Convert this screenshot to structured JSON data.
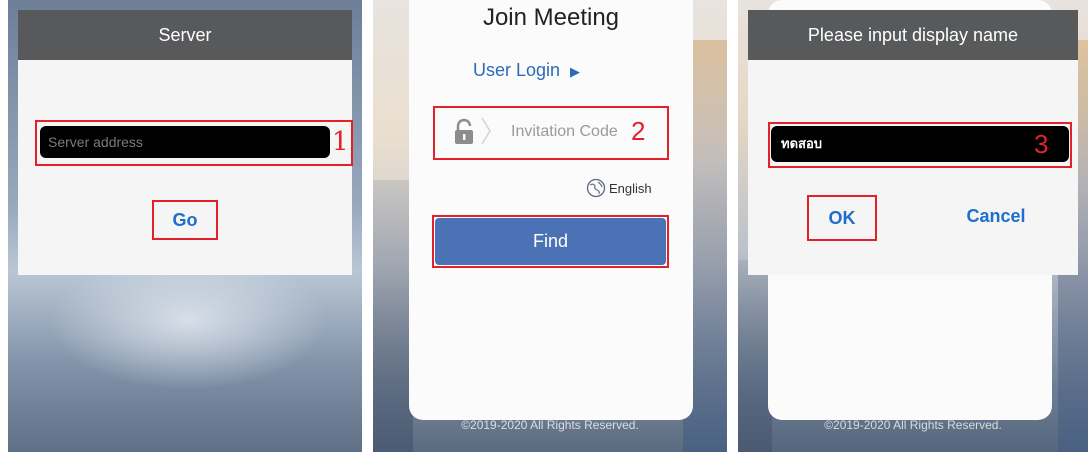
{
  "panel1": {
    "title": "Server",
    "server_placeholder": "Server address",
    "step_label": "1",
    "go_label": "Go"
  },
  "panel2": {
    "title": "Join Meeting",
    "user_login": "User Login",
    "invitation_placeholder": "Invitation Code",
    "step_label": "2",
    "language": "English",
    "find_label": "Find",
    "copyright": "©2019-2020 All Rights Reserved."
  },
  "panel3": {
    "title": "Please input display name",
    "name_value": "ทดสอบ",
    "step_label": "3",
    "ok_label": "OK",
    "cancel_label": "Cancel",
    "copyright": "©2019-2020 All Rights Reserved."
  },
  "colors": {
    "highlight_red": "#e3212a",
    "link_blue": "#1d6fcb",
    "find_button": "#4a72b5",
    "title_bar": "#58595b"
  },
  "icons": [
    "lock-icon",
    "chevron-right-icon",
    "play-triangle-icon",
    "globe-icon"
  ]
}
